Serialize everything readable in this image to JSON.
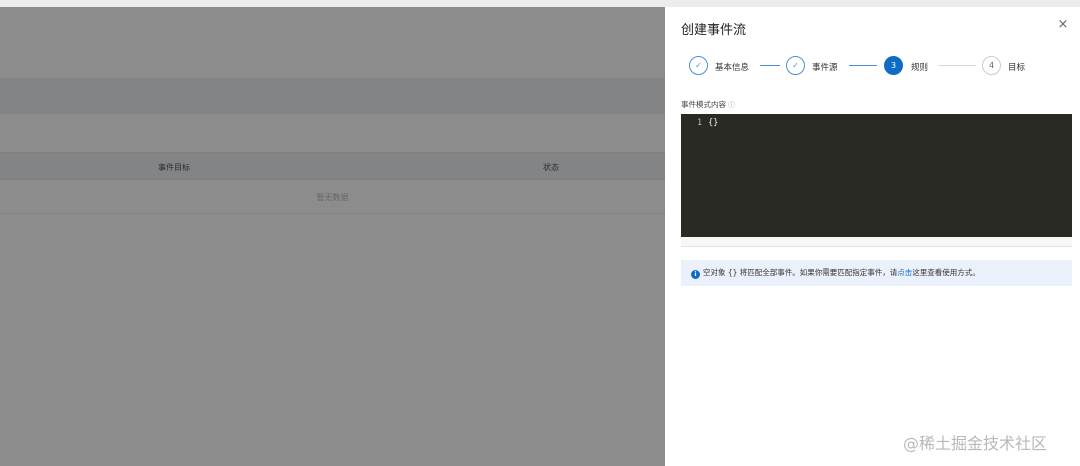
{
  "background": {
    "table": {
      "columns": [
        "事件目标",
        "状态"
      ],
      "empty_text": "暂无数据"
    }
  },
  "drawer": {
    "title": "创建事件流",
    "close_icon": "×",
    "steps": [
      {
        "label": "基本信息",
        "status": "done",
        "icon": "✓"
      },
      {
        "label": "事件源",
        "status": "done",
        "icon": "✓"
      },
      {
        "label": "规则",
        "status": "active",
        "number": "3"
      },
      {
        "label": "目标",
        "status": "pending",
        "number": "4"
      }
    ],
    "field_label": "事件模式内容",
    "help_icon": "ⓘ",
    "editor": {
      "line_number": "1",
      "content": "{}"
    },
    "info": {
      "icon": "i",
      "text_before": "空对象 {} 将匹配全部事件。如果你需要匹配指定事件，请",
      "link": "点击",
      "text_after": "这里查看使用方式。"
    }
  },
  "watermark": "@稀土掘金技术社区",
  "colors": {
    "accent": "#0f6cc5",
    "editor_bg": "#2a2a25",
    "info_bg": "#eaf1fb"
  }
}
